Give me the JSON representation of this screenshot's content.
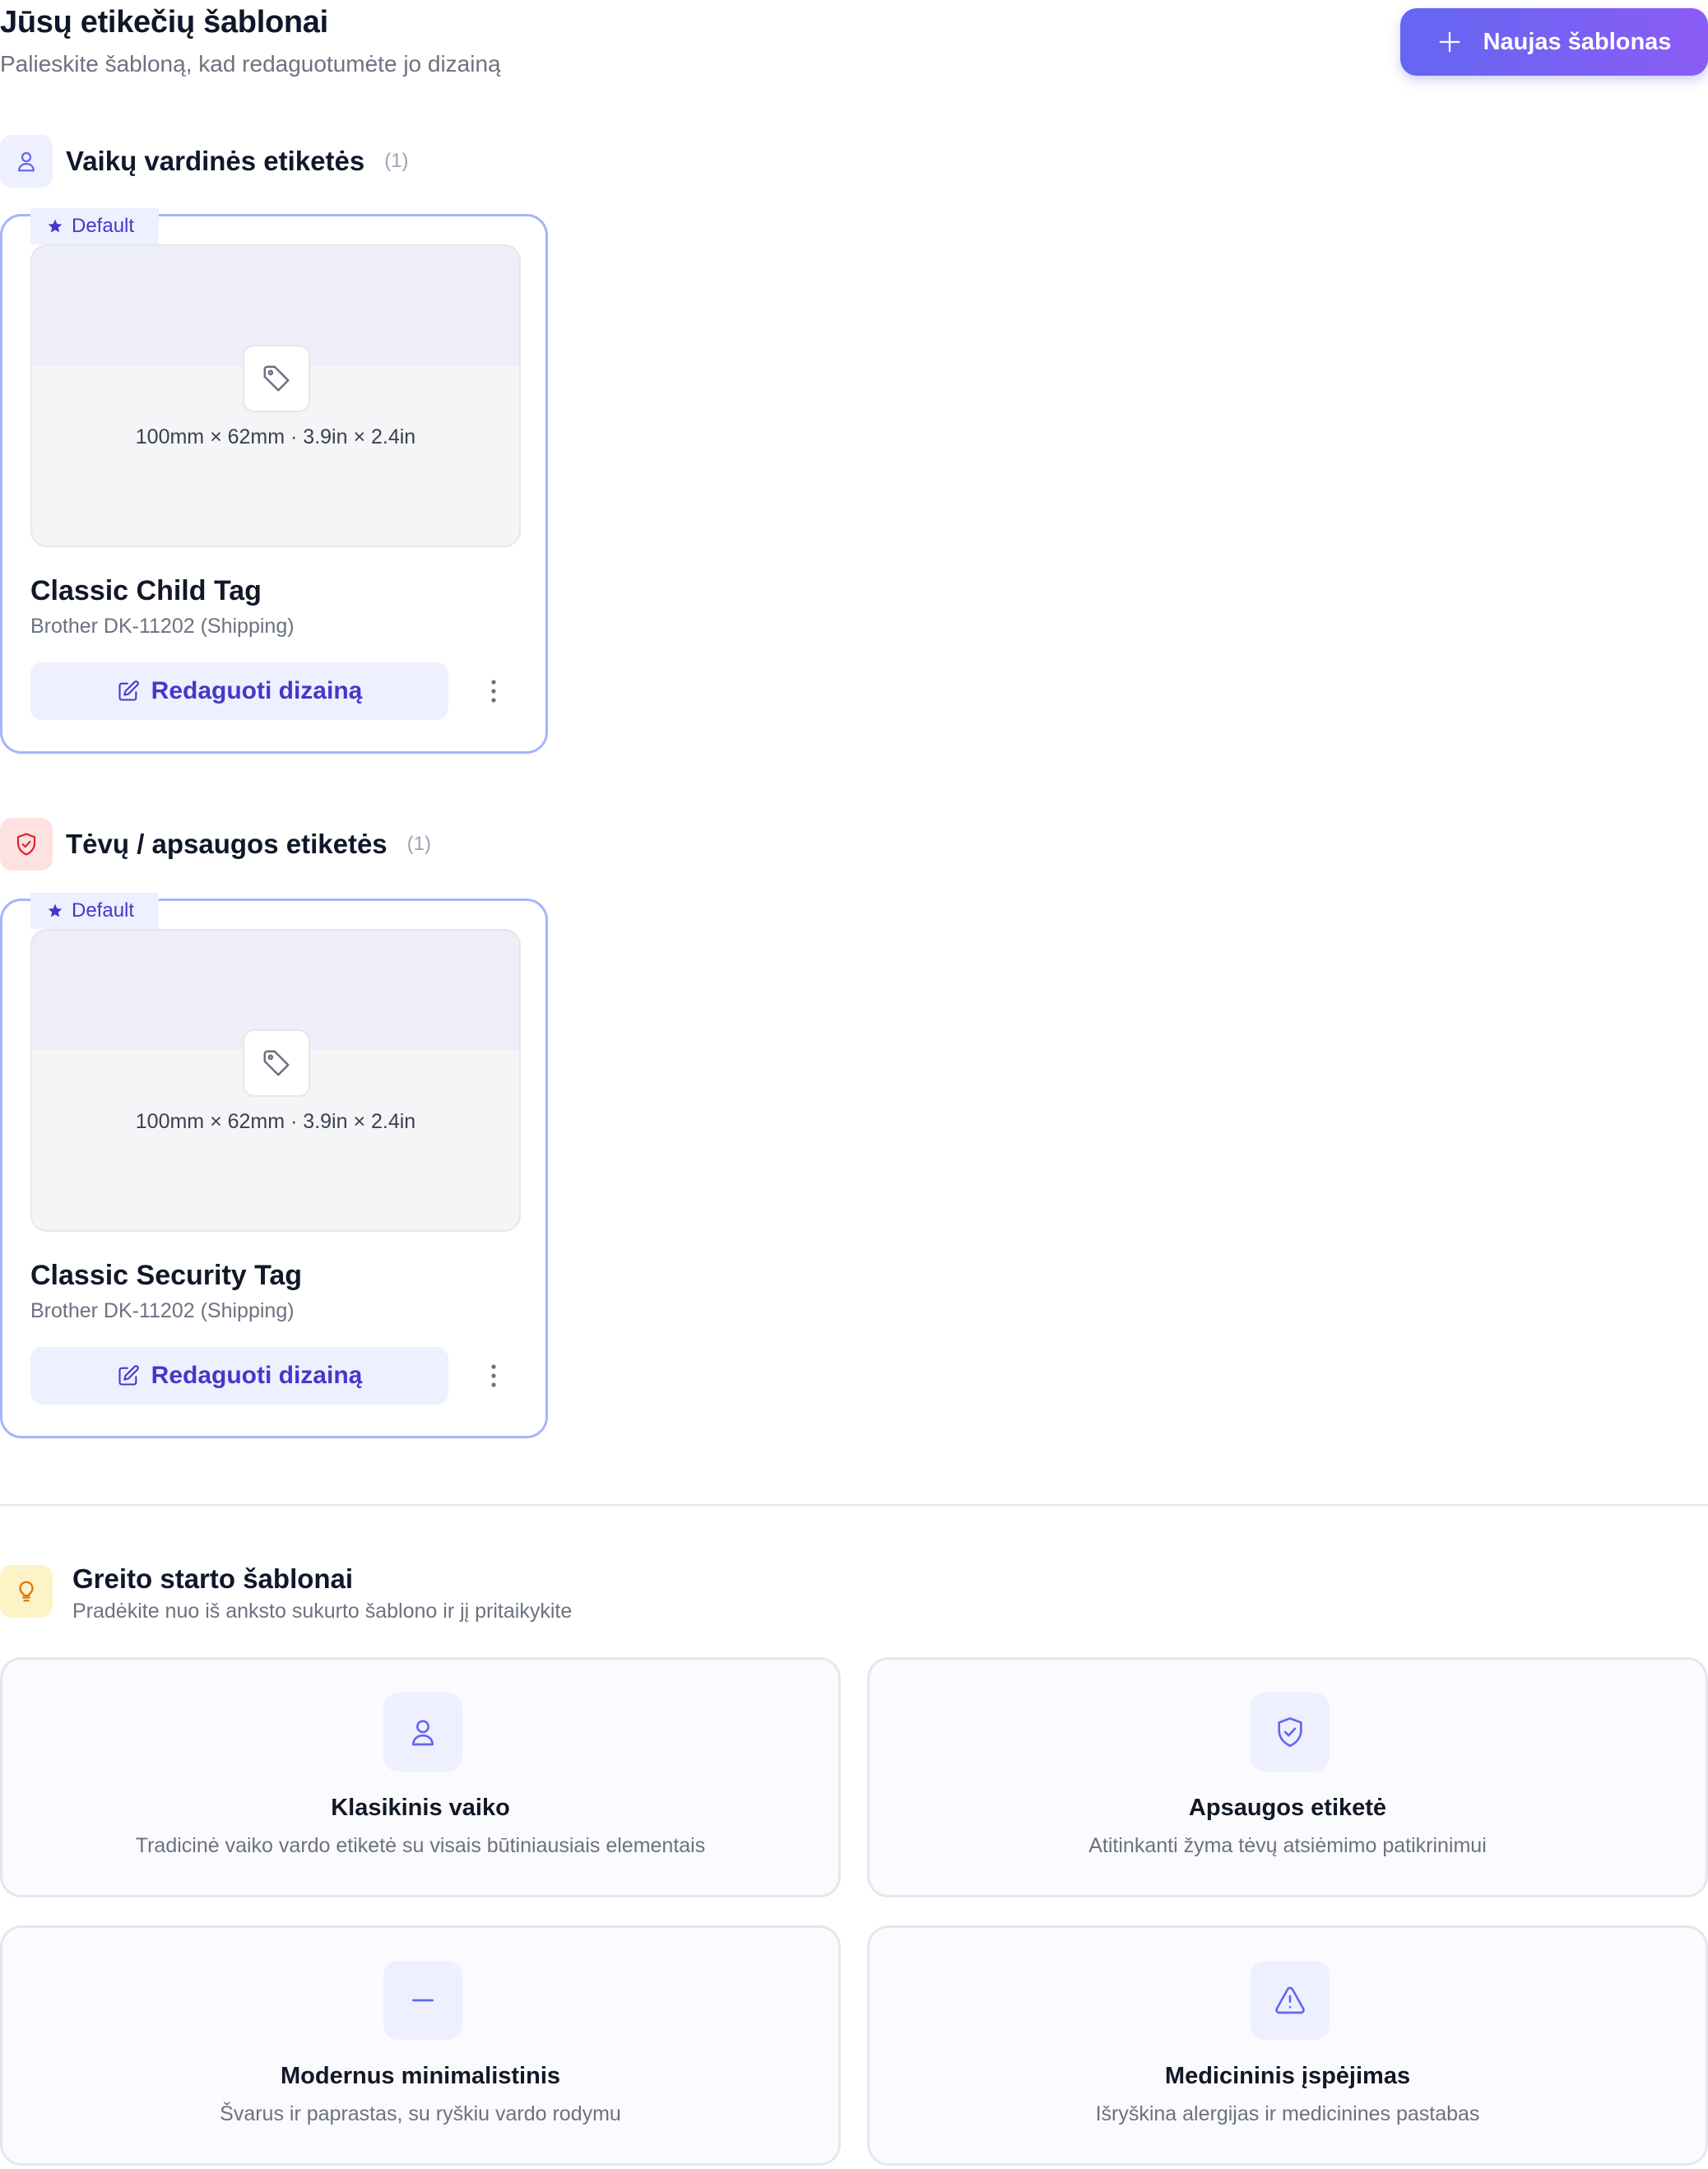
{
  "header": {
    "title": "Jūsų etikečių šablonai",
    "subtitle": "Palieskite šabloną, kad redaguotumėte jo dizainą",
    "new_button_label": "Naujas šablonas"
  },
  "categories": [
    {
      "title": "Vaikų vardinės etiketės",
      "count": "(1)",
      "icon": "user-icon",
      "template": {
        "badge": "Default",
        "dimensions": "100mm × 62mm · 3.9in × 2.4in",
        "name": "Classic Child Tag",
        "printer": "Brother DK-11202 (Shipping)",
        "edit_label": "Redaguoti dizainą"
      }
    },
    {
      "title": "Tėvų / apsaugos etiketės",
      "count": "(1)",
      "icon": "shield-check-icon",
      "template": {
        "badge": "Default",
        "dimensions": "100mm × 62mm · 3.9in × 2.4in",
        "name": "Classic Security Tag",
        "printer": "Brother DK-11202 (Shipping)",
        "edit_label": "Redaguoti dizainą"
      }
    }
  ],
  "quick_start": {
    "title": "Greito starto šablonai",
    "subtitle": "Pradėkite nuo iš anksto sukurto šablono ir jį pritaikykite",
    "items": [
      {
        "title": "Klasikinis vaiko",
        "description": "Tradicinė vaiko vardo etiketė su visais būtiniausiais elementais",
        "icon": "user-icon"
      },
      {
        "title": "Apsaugos etiketė",
        "description": "Atitinkanti žyma tėvų atsiėmimo patikrinimui",
        "icon": "shield-check-icon"
      },
      {
        "title": "Modernus minimalistinis",
        "description": "Švarus ir paprastas, su ryškiu vardo rodymu",
        "icon": "minus-icon"
      },
      {
        "title": "Medicininis įspėjimas",
        "description": "Išryškina alergijas ir medicinines pastabas",
        "icon": "warning-icon"
      }
    ]
  },
  "colors": {
    "accent": "#6366f1",
    "accent_end": "#8b5cf6",
    "accent_text": "#4338ca",
    "card_border": "#a5b4fc"
  }
}
